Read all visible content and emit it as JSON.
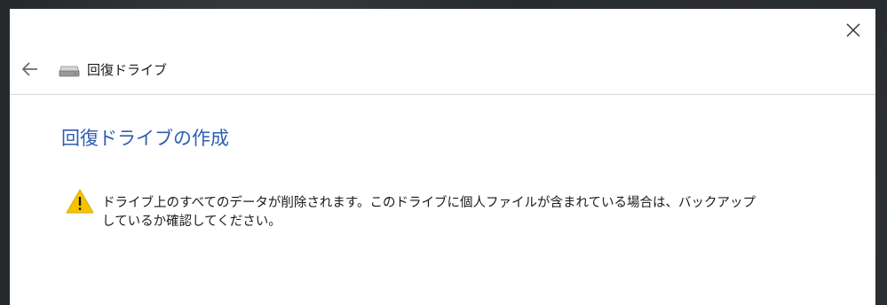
{
  "nav": {
    "back_icon": "back-arrow-icon",
    "drive_icon": "drive-icon",
    "breadcrumb": "回復ドライブ"
  },
  "window": {
    "close_icon": "close-icon"
  },
  "main": {
    "title": "回復ドライブの作成",
    "warning_icon": "warning-icon",
    "warning_text": "ドライブ上のすべてのデータが削除されます。このドライブに個人ファイルが含まれている場合は、バックアップしているか確認してください。"
  },
  "colors": {
    "title": "#2f5fae",
    "warning_fill": "#f5c400",
    "background": "#26292c"
  }
}
